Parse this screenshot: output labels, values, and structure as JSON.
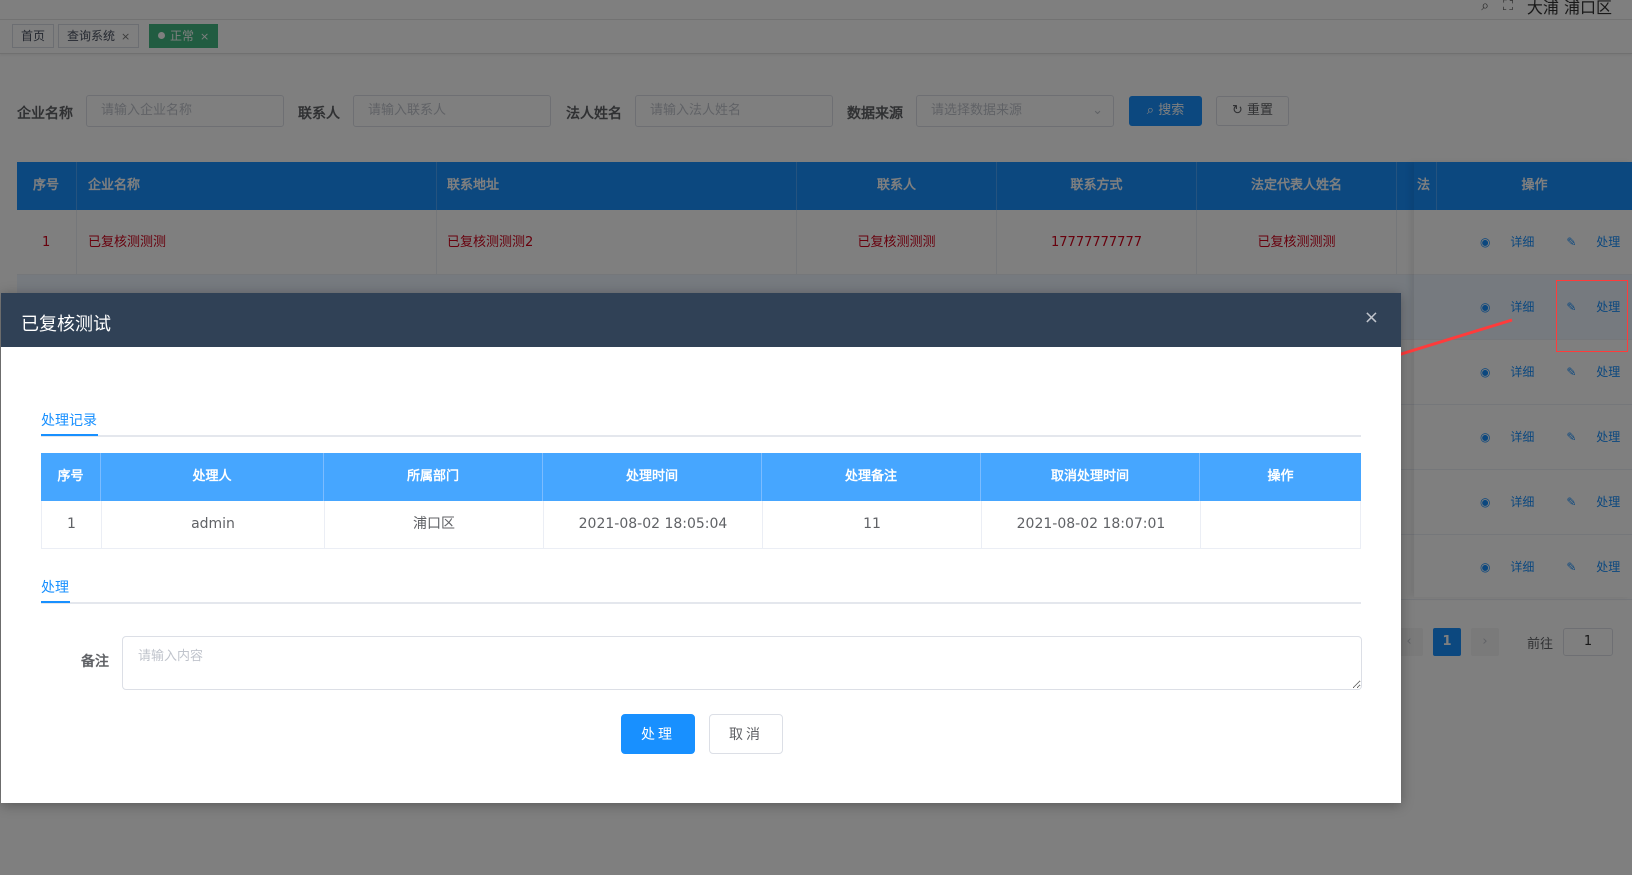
{
  "topbar": {
    "user_text": "大浦 浦口区"
  },
  "tags": [
    {
      "label": "首页",
      "closable": false,
      "active": false
    },
    {
      "label": "查询系统",
      "closable": true,
      "active": false
    },
    {
      "label": "正常",
      "closable": true,
      "active": true
    }
  ],
  "close_glyph": "×",
  "search": {
    "company_label": "企业名称",
    "company_placeholder": "请输入企业名称",
    "contact_label": "联系人",
    "contact_placeholder": "请输入联系人",
    "legal_label": "法人姓名",
    "legal_placeholder": "请输入法人姓名",
    "source_label": "数据来源",
    "source_placeholder": "请选择数据来源",
    "search_button": "搜索",
    "reset_button": "重置"
  },
  "main_table": {
    "columns": [
      "序号",
      "企业名称",
      "联系地址",
      "联系人",
      "联系方式",
      "法定代表人姓名",
      "法",
      "操作"
    ],
    "first_row": {
      "index": "1",
      "company": "已复核测测测",
      "address": "已复核测测测2",
      "contact": "已复核测测测",
      "phone": "17777777777",
      "legal": "已复核测测测"
    },
    "op_detail": "详细",
    "op_process": "处理"
  },
  "pager": {
    "current": "1",
    "jump_label": "前往",
    "jump_value": "1",
    "prev": "‹",
    "next": "›"
  },
  "dialog": {
    "title": "已复核测试",
    "close": "×",
    "records_tab": "处理记录",
    "columns": [
      "序号",
      "处理人",
      "所属部门",
      "处理时间",
      "处理备注",
      "取消处理时间",
      "操作"
    ],
    "row": {
      "index": "1",
      "handler": "admin",
      "dept": "浦口区",
      "time": "2021-08-02 18:05:04",
      "remark": "11",
      "cancel_time": "2021-08-02 18:07:01",
      "op": ""
    },
    "process_tab": "处理",
    "note_label": "备注",
    "note_placeholder": "请输入内容",
    "submit_button": "处理",
    "cancel_button": "取消"
  },
  "colors": {
    "primary": "#1890ff",
    "header_dark": "#304156",
    "tag_active": "#42b983",
    "row_text_red": "#d0021b",
    "annotation_red": "#ff3b3b"
  },
  "icons": {
    "search": "search-icon",
    "reset": "refresh-icon",
    "detail": "eye-icon",
    "process": "edit-icon",
    "select": "chevron-down-icon",
    "close": "close-icon"
  }
}
